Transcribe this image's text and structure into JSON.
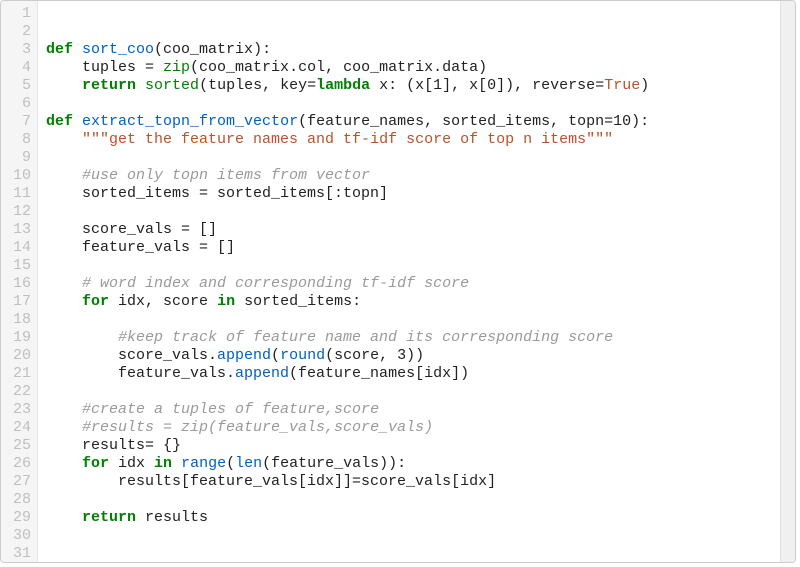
{
  "editor": {
    "line_count": 31,
    "lines": [
      [],
      [],
      [
        {
          "t": "kw",
          "v": "def"
        },
        {
          "t": "sp",
          "v": " "
        },
        {
          "t": "fn",
          "v": "sort_coo"
        },
        {
          "t": "pl",
          "v": "(coo_matrix):"
        }
      ],
      [
        {
          "t": "pl",
          "v": "    tuples = "
        },
        {
          "t": "bi",
          "v": "zip"
        },
        {
          "t": "pl",
          "v": "(coo_matrix.col, coo_matrix.data)"
        }
      ],
      [
        {
          "t": "pl",
          "v": "    "
        },
        {
          "t": "kw",
          "v": "return"
        },
        {
          "t": "pl",
          "v": " "
        },
        {
          "t": "bi",
          "v": "sorted"
        },
        {
          "t": "pl",
          "v": "(tuples, key="
        },
        {
          "t": "kw",
          "v": "lambda"
        },
        {
          "t": "pl",
          "v": " x: (x["
        },
        {
          "t": "num",
          "v": "1"
        },
        {
          "t": "pl",
          "v": "], x["
        },
        {
          "t": "num",
          "v": "0"
        },
        {
          "t": "pl",
          "v": "]), reverse="
        },
        {
          "t": "str",
          "v": "True"
        },
        {
          "t": "pl",
          "v": ")"
        }
      ],
      [],
      [
        {
          "t": "kw",
          "v": "def"
        },
        {
          "t": "sp",
          "v": " "
        },
        {
          "t": "fn",
          "v": "extract_topn_from_vector"
        },
        {
          "t": "pl",
          "v": "(feature_names, sorted_items, topn="
        },
        {
          "t": "num",
          "v": "10"
        },
        {
          "t": "pl",
          "v": "):"
        }
      ],
      [
        {
          "t": "pl",
          "v": "    "
        },
        {
          "t": "str",
          "v": "\"\"\"get the feature names and tf-idf score of top n items\"\"\""
        }
      ],
      [],
      [
        {
          "t": "pl",
          "v": "    "
        },
        {
          "t": "com",
          "v": "#use only topn items from vector"
        }
      ],
      [
        {
          "t": "pl",
          "v": "    sorted_items = sorted_items[:topn]"
        }
      ],
      [],
      [
        {
          "t": "pl",
          "v": "    score_vals = []"
        }
      ],
      [
        {
          "t": "pl",
          "v": "    feature_vals = []"
        }
      ],
      [],
      [
        {
          "t": "pl",
          "v": "    "
        },
        {
          "t": "com",
          "v": "# word index and corresponding tf-idf score"
        }
      ],
      [
        {
          "t": "pl",
          "v": "    "
        },
        {
          "t": "kw",
          "v": "for"
        },
        {
          "t": "pl",
          "v": " idx, score "
        },
        {
          "t": "kw",
          "v": "in"
        },
        {
          "t": "pl",
          "v": " sorted_items:"
        }
      ],
      [],
      [
        {
          "t": "pl",
          "v": "        "
        },
        {
          "t": "com",
          "v": "#keep track of feature name and its corresponding score"
        }
      ],
      [
        {
          "t": "pl",
          "v": "        score_vals."
        },
        {
          "t": "fn",
          "v": "append"
        },
        {
          "t": "pl",
          "v": "("
        },
        {
          "t": "fn",
          "v": "round"
        },
        {
          "t": "pl",
          "v": "(score, "
        },
        {
          "t": "num",
          "v": "3"
        },
        {
          "t": "pl",
          "v": "))"
        }
      ],
      [
        {
          "t": "pl",
          "v": "        feature_vals."
        },
        {
          "t": "fn",
          "v": "append"
        },
        {
          "t": "pl",
          "v": "(feature_names[idx])"
        }
      ],
      [],
      [
        {
          "t": "pl",
          "v": "    "
        },
        {
          "t": "com",
          "v": "#create a tuples of feature,score"
        }
      ],
      [
        {
          "t": "pl",
          "v": "    "
        },
        {
          "t": "com",
          "v": "#results = zip(feature_vals,score_vals)"
        }
      ],
      [
        {
          "t": "pl",
          "v": "    results= {}"
        }
      ],
      [
        {
          "t": "pl",
          "v": "    "
        },
        {
          "t": "kw",
          "v": "for"
        },
        {
          "t": "pl",
          "v": " idx "
        },
        {
          "t": "kw",
          "v": "in"
        },
        {
          "t": "pl",
          "v": " "
        },
        {
          "t": "fn",
          "v": "range"
        },
        {
          "t": "pl",
          "v": "("
        },
        {
          "t": "fn",
          "v": "len"
        },
        {
          "t": "pl",
          "v": "(feature_vals)):"
        }
      ],
      [
        {
          "t": "pl",
          "v": "        results[feature_vals[idx]]=score_vals[idx]"
        }
      ],
      [],
      [
        {
          "t": "pl",
          "v": "    "
        },
        {
          "t": "kw",
          "v": "return"
        },
        {
          "t": "pl",
          "v": " results"
        }
      ],
      [],
      []
    ]
  }
}
